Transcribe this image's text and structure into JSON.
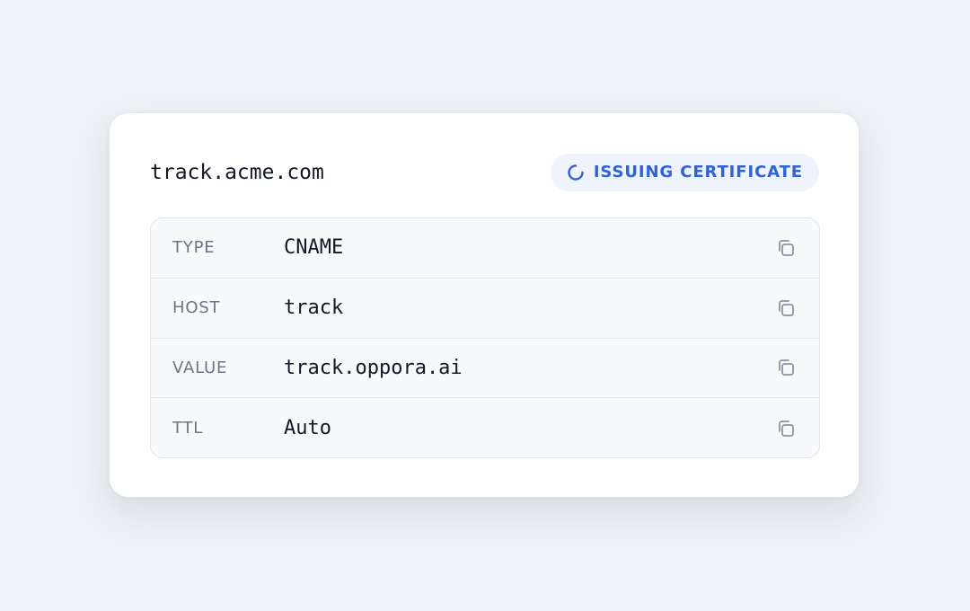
{
  "domain": {
    "name": "track.acme.com"
  },
  "status": {
    "label": "ISSUING CERTIFICATE",
    "icon": "spinner-icon",
    "color": "#2f62d8",
    "background": "#eef3fd"
  },
  "records": [
    {
      "key": "TYPE",
      "value": "CNAME",
      "copy_icon": "copy-icon"
    },
    {
      "key": "HOST",
      "value": "track",
      "copy_icon": "copy-icon"
    },
    {
      "key": "VALUE",
      "value": "track.oppora.ai",
      "copy_icon": "copy-icon"
    },
    {
      "key": "TTL",
      "value": "Auto",
      "copy_icon": "copy-icon"
    }
  ],
  "colors": {
    "page_background": "#eef1f5",
    "card_background": "#ffffff",
    "table_background": "#f7f9fb",
    "key_text": "#6b7585",
    "value_text": "#121826",
    "icon": "#8a94a3"
  }
}
